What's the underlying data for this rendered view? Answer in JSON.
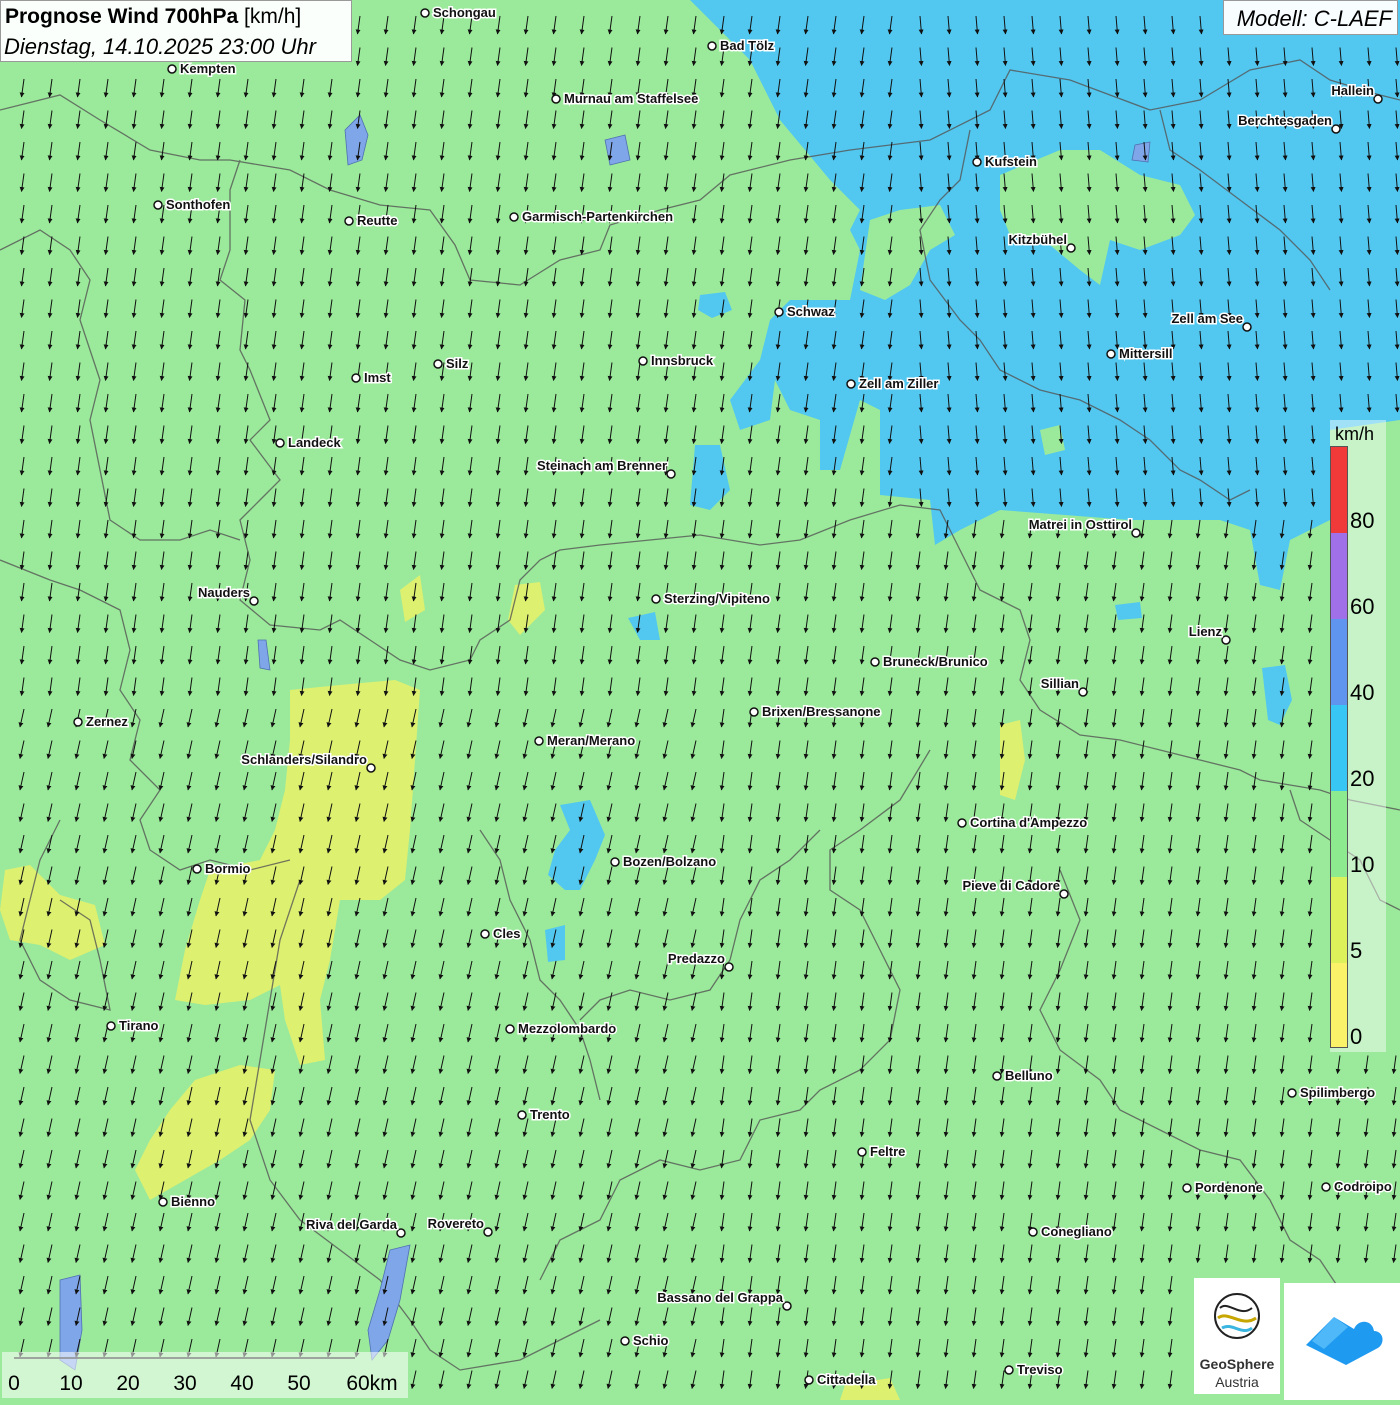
{
  "header": {
    "title": "Prognose Wind 700hPa",
    "unit": "[km/h]",
    "datetime": "Dienstag, 14.10.2025 23:00 Uhr",
    "model": "Modell: C-LAEF"
  },
  "legend": {
    "unit": "km/h",
    "ticks": [
      "80",
      "60",
      "40",
      "20",
      "10",
      "5",
      "0"
    ],
    "colors": [
      "#F03A3A",
      "#A070E8",
      "#5F95EE",
      "#38C6F5",
      "#8EEA8E",
      "#DDF25A",
      "#FAF36A"
    ]
  },
  "scale": {
    "labels": [
      "0",
      "10",
      "20",
      "30",
      "40",
      "50",
      "60km"
    ]
  },
  "logos": {
    "geosphere_line1": "GeoSphere",
    "geosphere_line2": "Austria",
    "geosphere_icon": "geosphere-logo-icon",
    "app_icon": "weather-app-cloud-icon"
  },
  "wind": {
    "direction": "from north-northeast",
    "arrow_icon": "wind-arrow-icon"
  },
  "places": [
    {
      "name": "Schongau",
      "label_side": "right"
    },
    {
      "name": "Bad Tölz",
      "label_side": "right"
    },
    {
      "name": "Kempten",
      "label_side": "right"
    },
    {
      "name": "Murnau am Staffelsee",
      "label_side": "right"
    },
    {
      "name": "Hallein",
      "label_side": "left"
    },
    {
      "name": "Berchtesgaden",
      "label_side": "left"
    },
    {
      "name": "Kufstein",
      "label_side": "right"
    },
    {
      "name": "Sonthofen",
      "label_side": "right"
    },
    {
      "name": "Reutte",
      "label_side": "right"
    },
    {
      "name": "Garmisch-Partenkirchen",
      "label_side": "right"
    },
    {
      "name": "Kitzbühel",
      "label_side": "left"
    },
    {
      "name": "Schwaz",
      "label_side": "right"
    },
    {
      "name": "Zell am See",
      "label_side": "left"
    },
    {
      "name": "Mittersill",
      "label_side": "right"
    },
    {
      "name": "Imst",
      "label_side": "right"
    },
    {
      "name": "Silz",
      "label_side": "right"
    },
    {
      "name": "Innsbruck",
      "label_side": "right"
    },
    {
      "name": "Zell am Ziller",
      "label_side": "right"
    },
    {
      "name": "Landeck",
      "label_side": "right"
    },
    {
      "name": "Steinach am Brenner",
      "label_side": "left"
    },
    {
      "name": "Matrei in Osttirol",
      "label_side": "left"
    },
    {
      "name": "Nauders",
      "label_side": "left"
    },
    {
      "name": "Sterzing/Vipiteno",
      "label_side": "right"
    },
    {
      "name": "Lienz",
      "label_side": "left"
    },
    {
      "name": "Bruneck/Brunico",
      "label_side": "right"
    },
    {
      "name": "Sillian",
      "label_side": "left"
    },
    {
      "name": "Zernez",
      "label_side": "right"
    },
    {
      "name": "Brixen/Bressanone",
      "label_side": "right"
    },
    {
      "name": "Meran/Merano",
      "label_side": "right"
    },
    {
      "name": "Schlanders/Silandro",
      "label_side": "left"
    },
    {
      "name": "Cortina d'Ampezzo",
      "label_side": "right"
    },
    {
      "name": "Bozen/Bolzano",
      "label_side": "right"
    },
    {
      "name": "Bormio",
      "label_side": "right"
    },
    {
      "name": "Pieve di Cadore",
      "label_side": "left"
    },
    {
      "name": "Cles",
      "label_side": "right"
    },
    {
      "name": "Predazzo",
      "label_side": "left"
    },
    {
      "name": "Tirano",
      "label_side": "right"
    },
    {
      "name": "Mezzolombardo",
      "label_side": "right"
    },
    {
      "name": "Belluno",
      "label_side": "right"
    },
    {
      "name": "Spilimbergo",
      "label_side": "right"
    },
    {
      "name": "Trento",
      "label_side": "right"
    },
    {
      "name": "Feltre",
      "label_side": "right"
    },
    {
      "name": "Pordenone",
      "label_side": "right"
    },
    {
      "name": "Codroipo",
      "label_side": "right"
    },
    {
      "name": "Bienno",
      "label_side": "right"
    },
    {
      "name": "Riva del Garda",
      "label_side": "left"
    },
    {
      "name": "Rovereto",
      "label_side": "left"
    },
    {
      "name": "Conegliano",
      "label_side": "right"
    },
    {
      "name": "Bassano del Grappa",
      "label_side": "left"
    },
    {
      "name": "Schio",
      "label_side": "right"
    },
    {
      "name": "Treviso",
      "label_side": "right"
    },
    {
      "name": "Cittadella",
      "label_side": "right"
    }
  ]
}
